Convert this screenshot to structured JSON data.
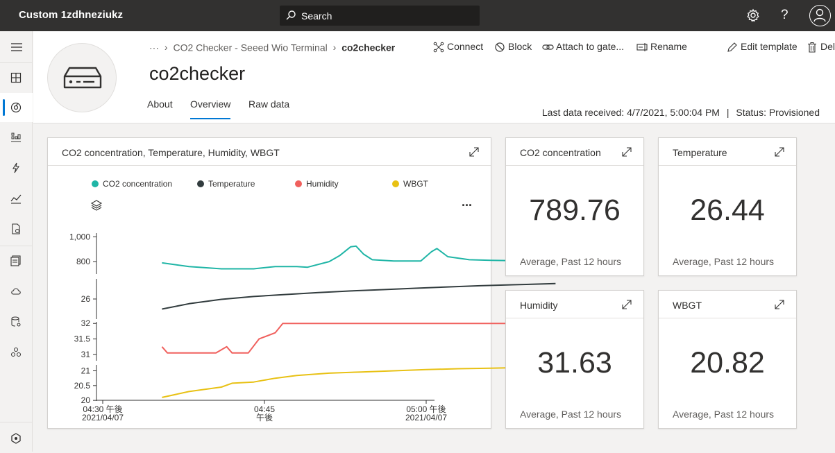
{
  "topbar": {
    "app_title": "Custom 1zdhneziukz",
    "search_label": "Search",
    "help_label": "?"
  },
  "breadcrumb": {
    "ellipsis": "···",
    "template": "CO2 Checker - Seeed Wio Terminal",
    "current": "co2checker"
  },
  "device": {
    "title": "co2checker",
    "last_data": "Last data received: 4/7/2021, 5:00:04 PM",
    "status": "Status: Provisioned"
  },
  "tabs": [
    {
      "label": "About"
    },
    {
      "label": "Overview"
    },
    {
      "label": "Raw data"
    }
  ],
  "actions": [
    {
      "label": "Connect",
      "icon": "connect-icon"
    },
    {
      "label": "Block",
      "icon": "block-icon"
    },
    {
      "label": "Attach to gate...",
      "icon": "attach-icon"
    },
    {
      "label": "Rename",
      "icon": "rename-icon"
    },
    {
      "label": "Edit template",
      "icon": "edit-icon"
    },
    {
      "label": "Delete",
      "icon": "delete-icon"
    }
  ],
  "chart_tile": {
    "title": "CO2 concentration, Temperature, Humidity, WBGT",
    "more": "···"
  },
  "kpis": [
    {
      "title": "CO2 concentration",
      "value": "789.76",
      "foot": "Average, Past 12 hours"
    },
    {
      "title": "Temperature",
      "value": "26.44",
      "foot": "Average, Past 12 hours"
    },
    {
      "title": "Humidity",
      "value": "31.63",
      "foot": "Average, Past 12 hours"
    },
    {
      "title": "WBGT",
      "value": "20.82",
      "foot": "Average, Past 12 hours"
    }
  ],
  "colors": {
    "co2": "#1fb5a6",
    "temperature": "#323c3e",
    "humidity": "#f0605d",
    "wbgt": "#e8c114",
    "accent": "#0078d4"
  },
  "chart_data": {
    "type": "line",
    "legend": [
      "CO2 concentration",
      "Temperature",
      "Humidity",
      "WBGT"
    ],
    "x_ticks": [
      {
        "t": 0,
        "line1": "04:30 午後",
        "line2": "2021/04/07"
      },
      {
        "t": 15,
        "line1": "04:45",
        "line2": "午後"
      },
      {
        "t": 30,
        "line1": "05:00 午後",
        "line2": "2021/04/07"
      }
    ],
    "x_range_minutes": [
      0,
      30
    ],
    "panels": [
      {
        "series": "CO2 concentration",
        "ticks": [
          "1,000",
          "800"
        ],
        "tick_values": [
          1000,
          800
        ],
        "ylim": [
          700,
          1030
        ],
        "points": [
          [
            5.5,
            790
          ],
          [
            8,
            760
          ],
          [
            11,
            742
          ],
          [
            14,
            742
          ],
          [
            16,
            760
          ],
          [
            18,
            760
          ],
          [
            19,
            755
          ],
          [
            21,
            800
          ],
          [
            22,
            850
          ],
          [
            23,
            920
          ],
          [
            23.5,
            925
          ],
          [
            24.2,
            860
          ],
          [
            25,
            815
          ],
          [
            27,
            805
          ],
          [
            29.5,
            805
          ],
          [
            30.5,
            880
          ],
          [
            31,
            905
          ],
          [
            32,
            840
          ],
          [
            34,
            815
          ],
          [
            36,
            810
          ],
          [
            38,
            808
          ],
          [
            40,
            808
          ],
          [
            42,
            812
          ]
        ]
      },
      {
        "series": "Temperature",
        "ticks": [
          "26"
        ],
        "tick_values": [
          26
        ],
        "ylim": [
          24.8,
          27.2
        ],
        "points": [
          [
            5.5,
            25.4
          ],
          [
            8,
            25.72
          ],
          [
            11,
            25.98
          ],
          [
            14,
            26.15
          ],
          [
            17,
            26.27
          ],
          [
            20,
            26.38
          ],
          [
            23,
            26.48
          ],
          [
            26,
            26.56
          ],
          [
            29,
            26.64
          ],
          [
            32,
            26.72
          ],
          [
            35,
            26.79
          ],
          [
            38,
            26.85
          ],
          [
            42,
            26.92
          ]
        ]
      },
      {
        "series": "Humidity",
        "ticks": [
          "32",
          "31.5",
          "31"
        ],
        "tick_values": [
          32,
          31.5,
          31
        ],
        "ylim": [
          30.8,
          32.05
        ],
        "points": [
          [
            5.5,
            31.25
          ],
          [
            6,
            31.05
          ],
          [
            10.5,
            31.05
          ],
          [
            11.5,
            31.25
          ],
          [
            12,
            31.05
          ],
          [
            13.5,
            31.05
          ],
          [
            14.5,
            31.5
          ],
          [
            16,
            31.7
          ],
          [
            16.7,
            32
          ],
          [
            20,
            32
          ],
          [
            25,
            32
          ],
          [
            30,
            32
          ],
          [
            36,
            32
          ],
          [
            42,
            32
          ]
        ]
      },
      {
        "series": "WBGT",
        "ticks": [
          "21",
          "20.5",
          "20"
        ],
        "tick_values": [
          21,
          20.5,
          20
        ],
        "ylim": [
          19.98,
          21.2
        ],
        "points": [
          [
            5.5,
            20.1
          ],
          [
            8,
            20.3
          ],
          [
            11,
            20.45
          ],
          [
            12,
            20.58
          ],
          [
            14,
            20.62
          ],
          [
            16,
            20.75
          ],
          [
            18,
            20.84
          ],
          [
            21,
            20.92
          ],
          [
            24,
            20.96
          ],
          [
            27,
            21
          ],
          [
            30,
            21.04
          ],
          [
            33,
            21.07
          ],
          [
            36,
            21.09
          ],
          [
            39,
            21.11
          ],
          [
            42,
            21.13
          ]
        ]
      }
    ]
  }
}
